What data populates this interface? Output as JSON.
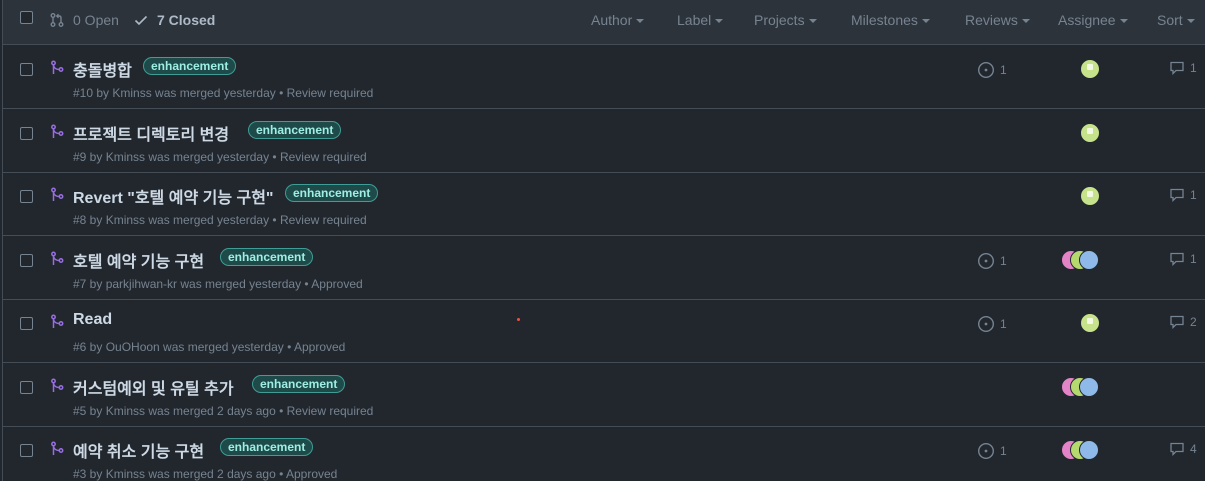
{
  "header": {
    "open_label": "0 Open",
    "closed_label": "7 Closed",
    "filters": [
      "Author",
      "Label",
      "Projects",
      "Milestones",
      "Reviews",
      "Assignee",
      "Sort"
    ]
  },
  "colors": {
    "background": "#22272e",
    "header_bg": "#2d333b",
    "merged_purple": "#986ee2",
    "label_text": "#9eeee3",
    "label_border": "#3f9d95"
  },
  "pull_requests": [
    {
      "title": "충돌병합",
      "label": "enhancement",
      "meta": "#10 by Kminss was merged yesterday • Review required",
      "linked_issues": "1",
      "comments": "1"
    },
    {
      "title": "프로젝트 디렉토리 변경",
      "label": "enhancement",
      "meta": "#9 by Kminss was merged yesterday • Review required",
      "linked_issues": "",
      "comments": ""
    },
    {
      "title": "Revert \"호텔 예약 기능 구현\"",
      "label": "enhancement",
      "meta": "#8 by Kminss was merged yesterday • Review required",
      "linked_issues": "",
      "comments": "1"
    },
    {
      "title": "호텔 예약 기능 구현",
      "label": "enhancement",
      "meta": "#7 by parkjihwan-kr was merged yesterday • Approved",
      "linked_issues": "1",
      "comments": "1"
    },
    {
      "title": "Read",
      "label": "",
      "meta": "#6 by OuOHoon was merged yesterday • Approved",
      "linked_issues": "1",
      "comments": "2"
    },
    {
      "title": "커스텀예외 및 유틸 추가",
      "label": "enhancement",
      "meta": "#5 by Kminss was merged 2 days ago • Review required",
      "linked_issues": "",
      "comments": ""
    },
    {
      "title": "예약 취소 기능 구현",
      "label": "enhancement",
      "meta": "#3 by Kminss was merged 2 days ago • Approved",
      "linked_issues": "1",
      "comments": "4"
    }
  ]
}
